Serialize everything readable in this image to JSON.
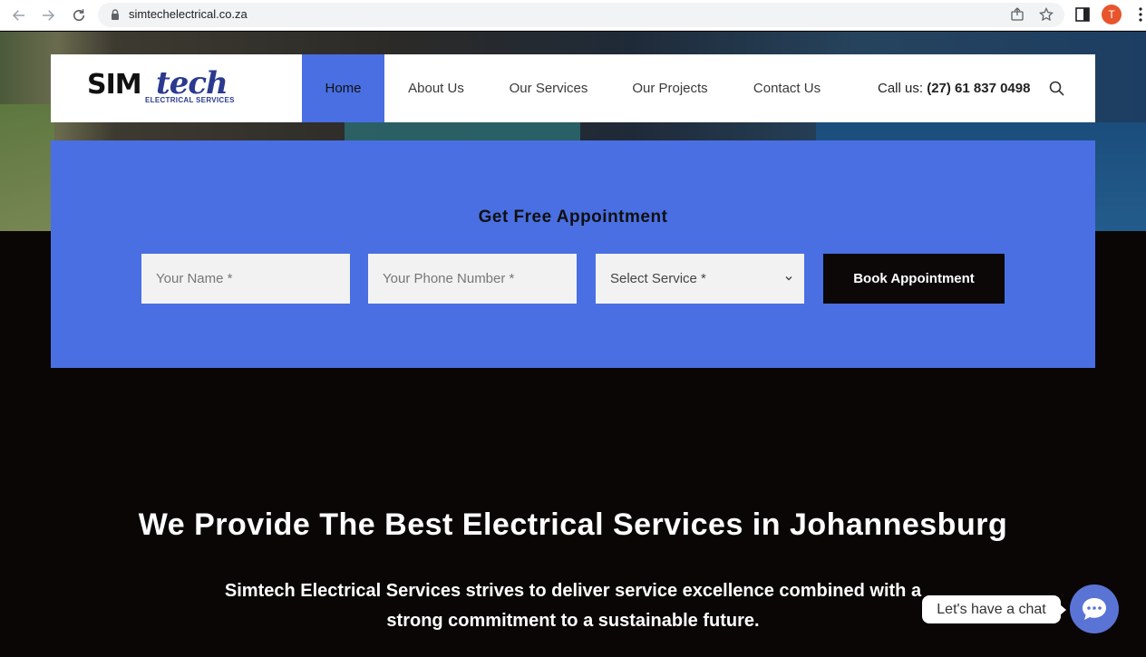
{
  "browser": {
    "url": "simtechelectrical.co.za",
    "profile_initial": "T"
  },
  "header": {
    "logo_main": "SIM",
    "logo_accent": "tech",
    "logo_sub": "ELECTRICAL SERVICES",
    "nav": [
      {
        "label": "Home",
        "active": true
      },
      {
        "label": "About Us"
      },
      {
        "label": "Our Services"
      },
      {
        "label": "Our Projects"
      },
      {
        "label": "Contact Us"
      }
    ],
    "call_label": "Call us:",
    "call_number": "(27) 61 837 0498"
  },
  "appointment": {
    "title": "Get Free Appointment",
    "name_placeholder": "Your Name *",
    "phone_placeholder": "Your Phone Number *",
    "service_select": "Select Service *",
    "book_button": "Book Appointment"
  },
  "main": {
    "headline": "We Provide The Best Electrical Services in Johannesburg",
    "subtext": "Simtech Electrical Services strives to deliver service excellence combined with a strong commitment to a sustainable future."
  },
  "chat": {
    "prompt": "Let's have a chat"
  },
  "colors": {
    "accent": "#4a6fe3",
    "dark": "#0b0606"
  }
}
